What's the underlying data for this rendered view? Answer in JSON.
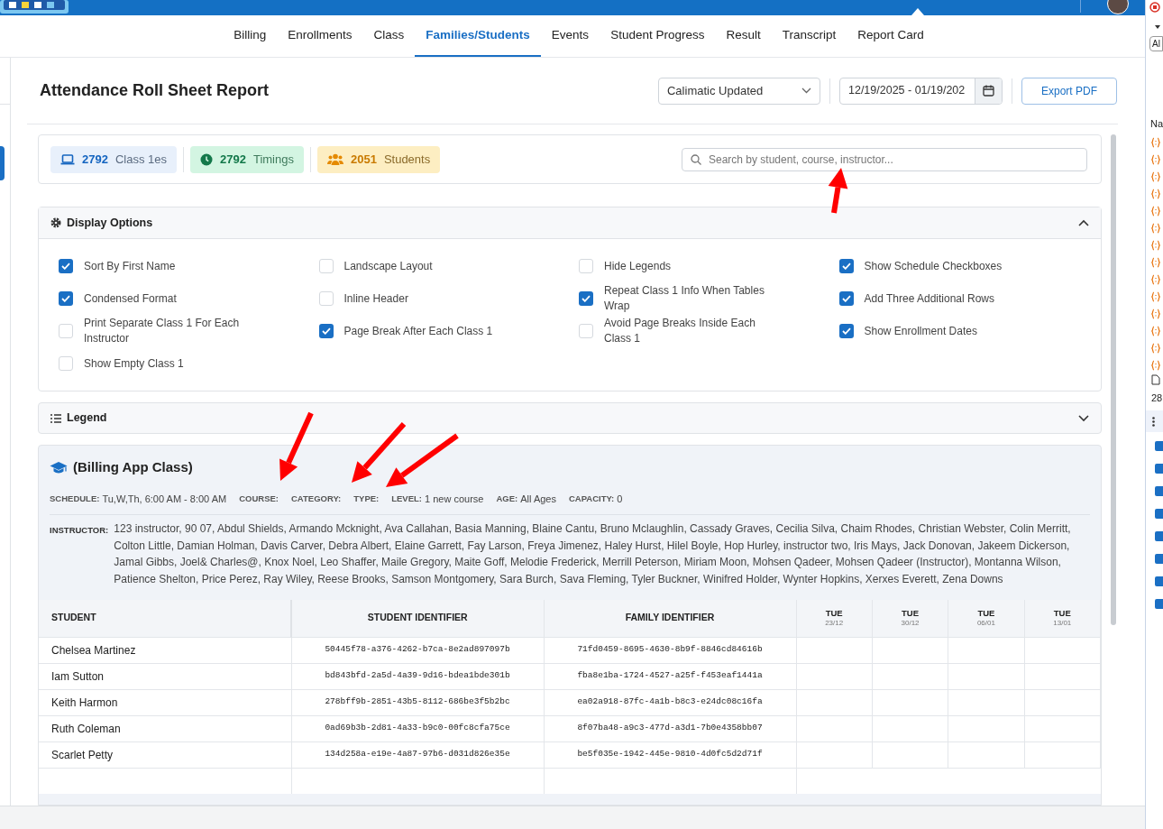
{
  "nav": [
    {
      "label": "Billing",
      "selected": false
    },
    {
      "label": "Enrollments",
      "selected": false
    },
    {
      "label": "Class",
      "selected": false
    },
    {
      "label": "Families/Students",
      "selected": true
    },
    {
      "label": "Events",
      "selected": false
    },
    {
      "label": "Student Progress",
      "selected": false
    },
    {
      "label": "Result",
      "selected": false
    },
    {
      "label": "Transcript",
      "selected": false
    },
    {
      "label": "Report Card",
      "selected": false
    }
  ],
  "header": {
    "title": "Attendance Roll Sheet Report",
    "template_select": "Calimatic Updated",
    "date_range": "12/19/2025 - 01/19/202",
    "export_button": "Export PDF"
  },
  "stats": [
    {
      "kind": "classes",
      "count": "2792",
      "label": "Class 1es"
    },
    {
      "kind": "timings",
      "count": "2792",
      "label": "Timings"
    },
    {
      "kind": "students",
      "count": "2051",
      "label": "Students"
    }
  ],
  "search": {
    "placeholder": "Search by student, course, instructor..."
  },
  "display_options": {
    "title": "Display Options",
    "expanded": true,
    "options": [
      {
        "label": "Sort By First Name",
        "checked": true
      },
      {
        "label": "Landscape Layout",
        "checked": false
      },
      {
        "label": "Hide Legends",
        "checked": false
      },
      {
        "label": "Show Schedule Checkboxes",
        "checked": true
      },
      {
        "label": "Condensed Format",
        "checked": true
      },
      {
        "label": "Inline Header",
        "checked": false
      },
      {
        "label": "Repeat Class 1 Info When Tables Wrap",
        "checked": true
      },
      {
        "label": "Add Three Additional Rows",
        "checked": true
      },
      {
        "label": "Print Separate Class 1 For Each Instructor",
        "checked": false
      },
      {
        "label": "Page Break After Each Class 1",
        "checked": true
      },
      {
        "label": "Avoid Page Breaks Inside Each Class 1",
        "checked": false
      },
      {
        "label": "Show Enrollment Dates",
        "checked": true
      },
      {
        "label": "Show Empty Class 1",
        "checked": false
      }
    ]
  },
  "legend": {
    "title": "Legend",
    "expanded": false
  },
  "class_section": {
    "title": "(Billing App Class)",
    "meta": [
      {
        "label": "SCHEDULE:",
        "value": "Tu,W,Th, 6:00 AM - 8:00 AM"
      },
      {
        "label": "COURSE:"
      },
      {
        "label": "CATEGORY:"
      },
      {
        "label": "TYPE:"
      },
      {
        "label": "LEVEL:",
        "value": "1 new course"
      },
      {
        "label": "AGE:",
        "value": "All Ages"
      },
      {
        "label": "CAPACITY:",
        "value": "0"
      }
    ],
    "instructor_label": "INSTRUCTOR:",
    "instructors": "123 instructor, 90 07, Abdul Shields, Armando Mcknight, Ava Callahan, Basia Manning, Blaine Cantu, Bruno Mclaughlin, Cassady Graves, Cecilia Silva, Chaim Rhodes, Christian Webster, Colin Merritt, Colton Little, Damian Holman, Davis Carver, Debra Albert, Elaine Garrett, Fay Larson, Freya Jimenez, Haley Hurst, Hilel Boyle, Hop Hurley, instructor two, Iris Mays, Jack Donovan, Jakeem Dickerson, Jamal Gibbs, Joel& Charles@, Knox Noel, Leo Shaffer, Maile Gregory, Maite Goff, Melodie Frederick, Merrill Peterson, Miriam Moon, Mohsen Qadeer, Mohsen Qadeer (Instructor), Montanna Wilson, Patience Shelton, Price Perez, Ray Wiley, Reese Brooks, Samson Montgomery, Sara Burch, Sava Fleming, Tyler Buckner, Winifred Holder, Wynter Hopkins, Xerxes Everett, Zena Downs"
  },
  "table": {
    "columns": [
      "STUDENT",
      "STUDENT IDENTIFIER",
      "FAMILY IDENTIFIER"
    ],
    "date_columns": [
      {
        "day": "TUE",
        "date": "23/12"
      },
      {
        "day": "TUE",
        "date": "30/12"
      },
      {
        "day": "TUE",
        "date": "06/01"
      },
      {
        "day": "TUE",
        "date": "13/01"
      }
    ],
    "rows": [
      {
        "student": "Chelsea Martinez",
        "student_id": "50445f78-a376-4262-b7ca-8e2ad897097b",
        "family_id": "71fd0459-8695-4630-8b9f-8846cd84616b"
      },
      {
        "student": "Iam Sutton",
        "student_id": "bd843bfd-2a5d-4a39-9d16-bdea1bde301b",
        "family_id": "fba8e1ba-1724-4527-a25f-f453eaf1441a"
      },
      {
        "student": "Keith Harmon",
        "student_id": "278bff9b-2851-43b5-8112-686be3f5b2bc",
        "family_id": "ea02a918-87fc-4a1b-b8c3-e24dc08c16fa"
      },
      {
        "student": "Ruth Coleman",
        "student_id": "0ad69b3b-2d81-4a33-b9c0-00fc8cfa75ce",
        "family_id": "8f07ba48-a9c3-477d-a3d1-7b0e4358bb07"
      },
      {
        "student": "Scarlet Petty",
        "student_id": "134d258a-e19e-4a87-97b6-d031d826e35e",
        "family_id": "be5f035e-1942-445e-9810-4d0fc5d2d71f"
      }
    ]
  },
  "side_panel": {
    "filter_text": "Al",
    "column_header": "Na",
    "count": "28"
  }
}
